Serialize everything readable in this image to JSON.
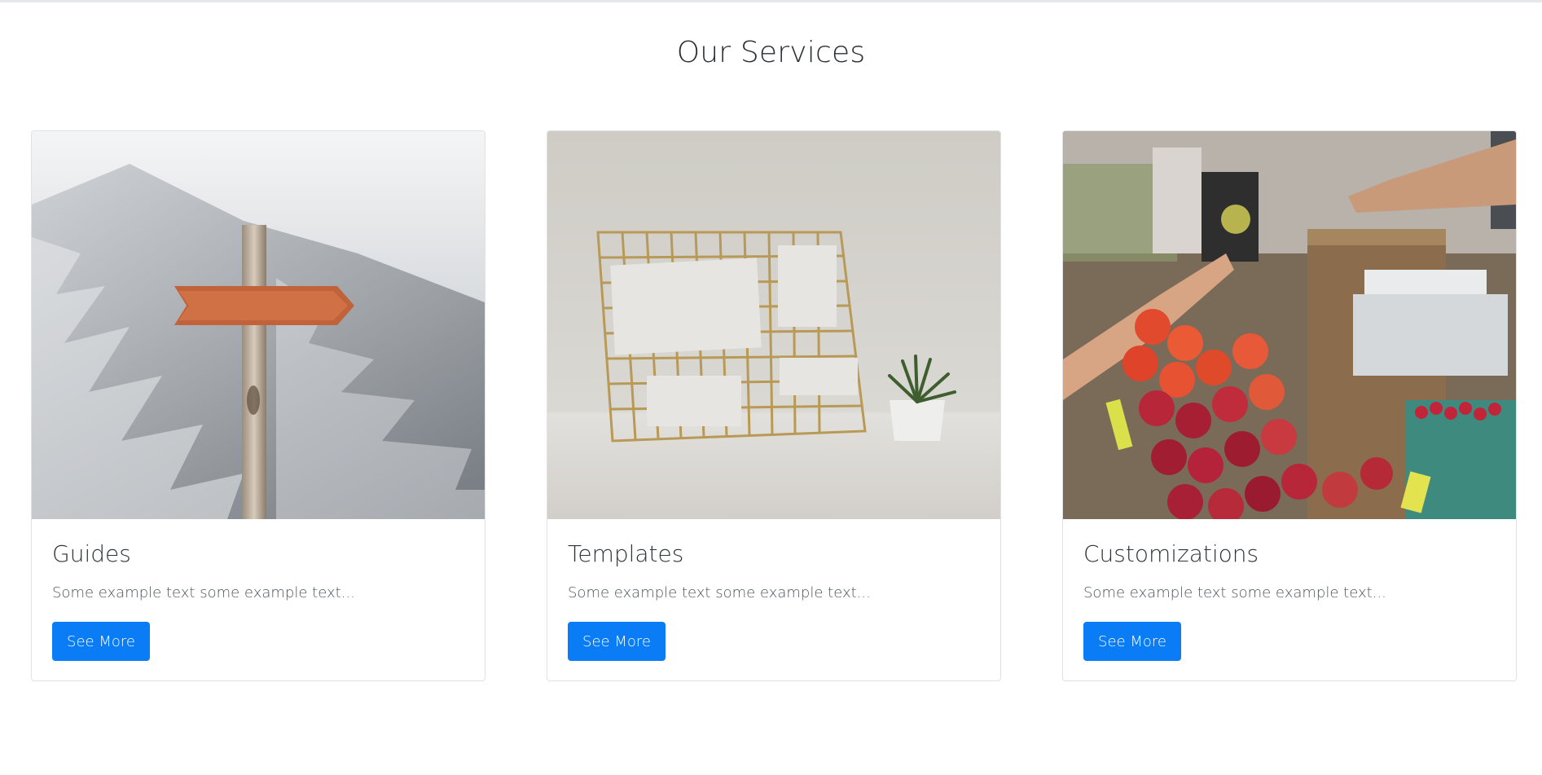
{
  "section": {
    "title": "Our Services"
  },
  "cards": [
    {
      "image": "signpost-snowy-mountain-photo",
      "title": "Guides",
      "text": "Some example text some example text...",
      "button": "See More"
    },
    {
      "image": "wire-grid-board-with-notes-photo",
      "title": "Templates",
      "text": "Some example text some example text...",
      "button": "See More"
    },
    {
      "image": "fruit-market-stall-photo",
      "title": "Customizations",
      "text": "Some example text some example text...",
      "button": "See More"
    }
  ],
  "colors": {
    "button_bg": "#0a7cf5",
    "button_text": "#ffffff",
    "card_border": "#dfe1e4"
  }
}
